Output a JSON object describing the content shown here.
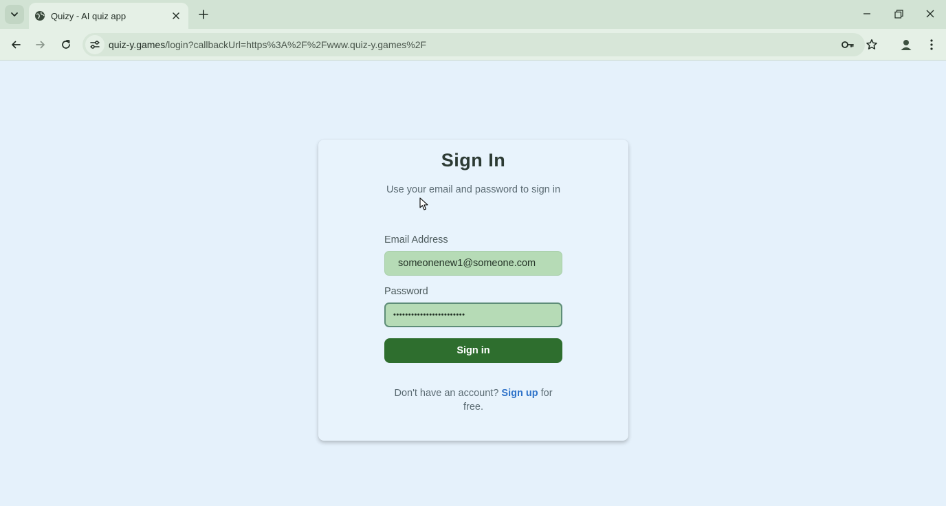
{
  "browser": {
    "tab": {
      "title": "Quizy - AI quiz app"
    },
    "address": {
      "host": "quiz-y.games",
      "path": "/login?callbackUrl=https%3A%2F%2Fwww.quiz-y.games%2F"
    },
    "icons": {
      "tab_search": "chevron-down-icon",
      "favicon": "globe-icon",
      "tab_close": "close-icon",
      "new_tab": "plus-icon",
      "minimize": "minimize-icon",
      "restore": "restore-icon",
      "close": "close-icon",
      "back": "arrow-left-icon",
      "forward": "arrow-right-icon",
      "reload": "reload-icon",
      "site_info": "tune-icon",
      "password_manager": "key-icon",
      "bookmark": "star-icon",
      "profile": "person-icon",
      "menu": "kebab-menu-icon"
    }
  },
  "signin": {
    "title": "Sign In",
    "subtitle": "Use your email and password to sign in",
    "email_label": "Email Address",
    "email_value": "someonenew1@someone.com",
    "password_label": "Password",
    "password_value": "••••••••••••••••••••••••",
    "button_label": "Sign in",
    "footer_prefix": "Don't have an account?",
    "signup_link": "Sign up",
    "footer_suffix": "for free."
  },
  "colors": {
    "page_bg": "#e5f1fb",
    "chrome_bg": "#e5f0e6",
    "input_bg": "#b6dbb6",
    "button_bg": "#2e6e2e",
    "link": "#2e72c9"
  }
}
